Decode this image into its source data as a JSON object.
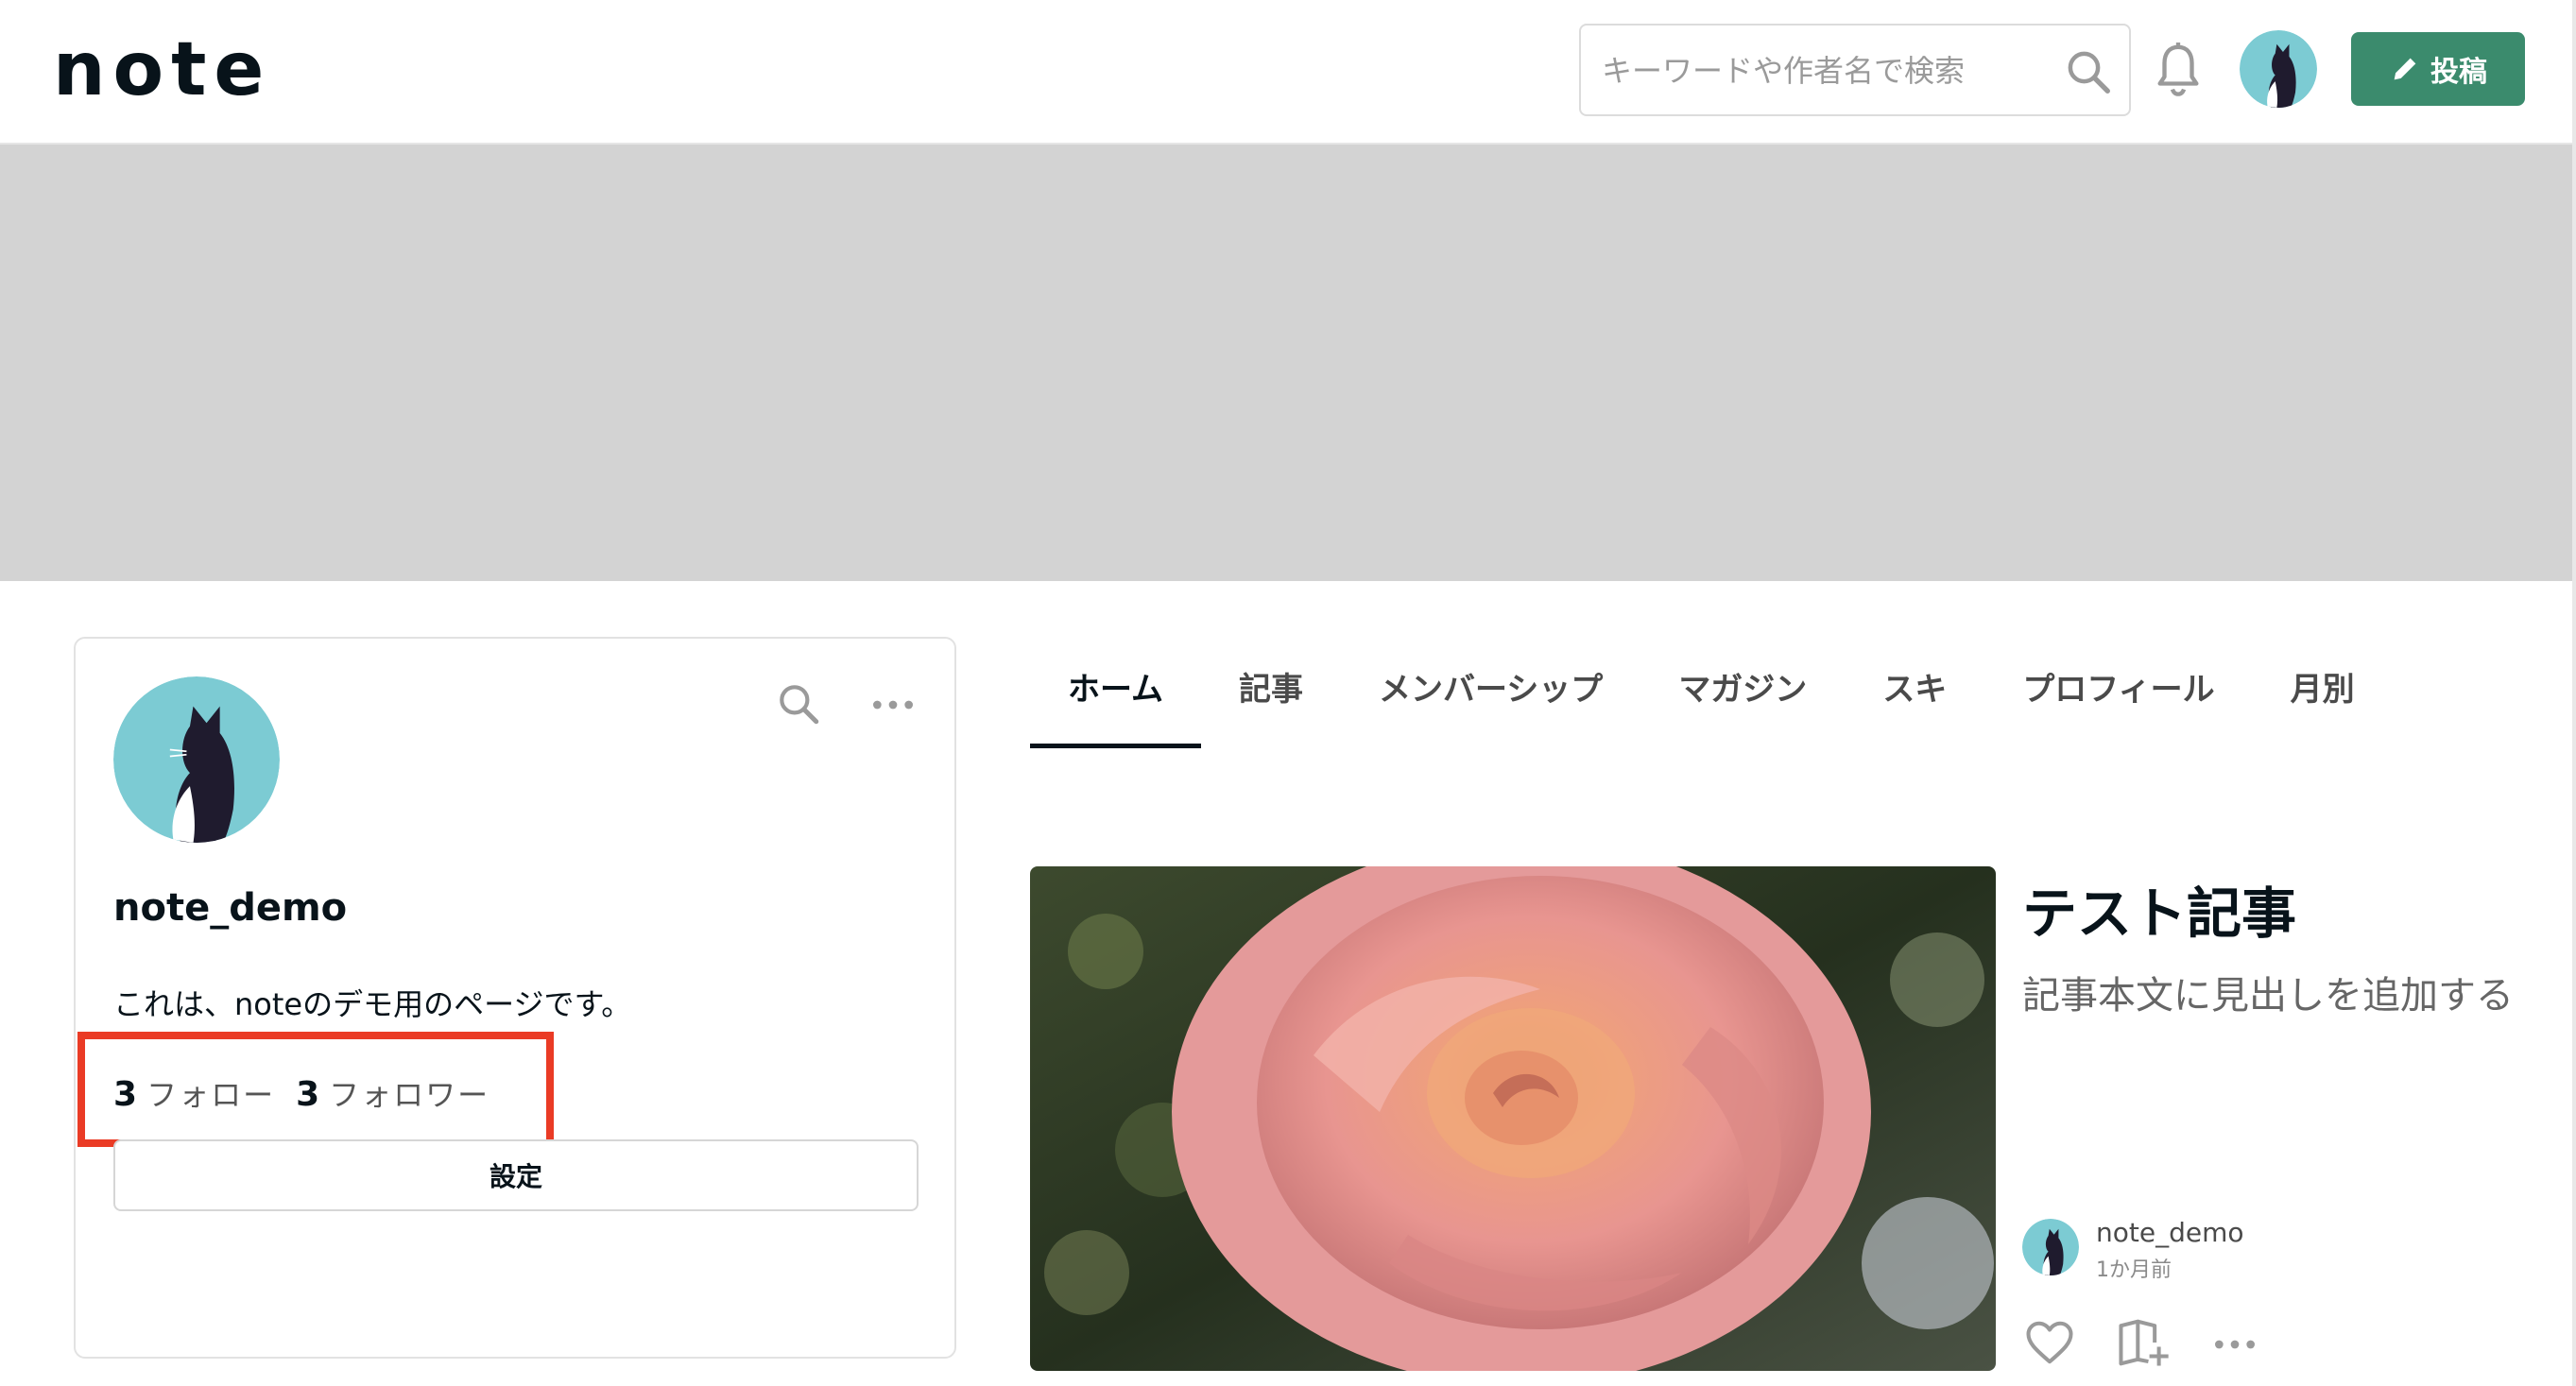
{
  "header": {
    "logo": "note",
    "search_placeholder": "キーワードや作者名で検索",
    "post_label": "投稿"
  },
  "profile": {
    "name": "note_demo",
    "description": "これは、noteのデモ用のページです。",
    "follow_count": "3",
    "follow_label": "フォロー",
    "follower_count": "3",
    "follower_label": "フォロワー",
    "settings_label": "設定"
  },
  "tabs": [
    {
      "label": "ホーム",
      "active": true
    },
    {
      "label": "記事"
    },
    {
      "label": "メンバーシップ"
    },
    {
      "label": "マガジン"
    },
    {
      "label": "スキ"
    },
    {
      "label": "プロフィール"
    },
    {
      "label": "月別"
    }
  ],
  "article": {
    "title": "テスト記事",
    "excerpt": "記事本文に見出しを追加する",
    "author": "note_demo",
    "time": "1か月前"
  },
  "colors": {
    "accent": "#3b8b6d",
    "highlight": "#ea3b25",
    "avatar_bg": "#7ccbd3",
    "banner": "#d3d3d3"
  },
  "icons": [
    "search-icon",
    "bell-icon",
    "pen-icon",
    "more-icon",
    "heart-icon",
    "magazine-add-icon"
  ]
}
